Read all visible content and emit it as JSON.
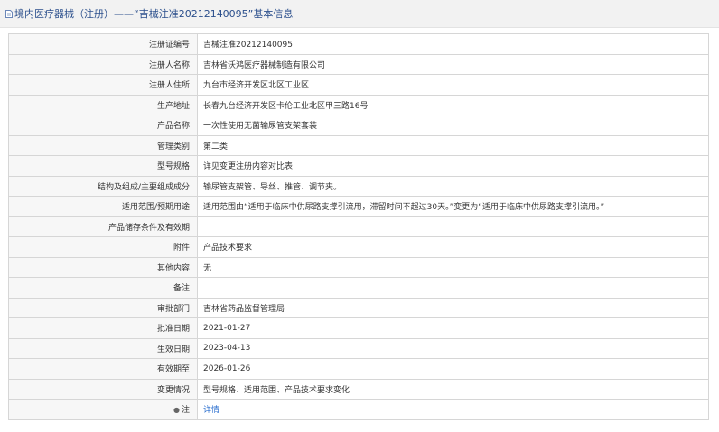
{
  "header": {
    "title": "境内医疗器械（注册）——“吉械注准20212140095”基本信息"
  },
  "rows": [
    {
      "label": "注册证编号",
      "value": "吉械注准20212140095"
    },
    {
      "label": "注册人名称",
      "value": "吉林省沃鸿医疗器械制造有限公司"
    },
    {
      "label": "注册人住所",
      "value": "九台市经济开发区北区工业区"
    },
    {
      "label": "生产地址",
      "value": "长春九台经济开发区卡伦工业北区甲三路16号"
    },
    {
      "label": "产品名称",
      "value": "一次性使用无菌输尿管支架套装"
    },
    {
      "label": "管理类别",
      "value": "第二类"
    },
    {
      "label": "型号规格",
      "value": "详见变更注册内容对比表"
    },
    {
      "label": "结构及组成/主要组成成分",
      "value": "输尿管支架管、导丝、推管、调节夹。"
    },
    {
      "label": "适用范围/预期用途",
      "value": "适用范围由“适用于临床中供尿路支撑引流用，滞留时间不超过30天。”变更为“适用于临床中供尿路支撑引流用。”"
    },
    {
      "label": "产品储存条件及有效期",
      "value": ""
    },
    {
      "label": "附件",
      "value": "产品技术要求"
    },
    {
      "label": "其他内容",
      "value": "无"
    },
    {
      "label": "备注",
      "value": ""
    },
    {
      "label": "审批部门",
      "value": "吉林省药品监督管理局"
    },
    {
      "label": "批准日期",
      "value": "2021-01-27"
    },
    {
      "label": "生效日期",
      "value": "2023-04-13"
    },
    {
      "label": "有效期至",
      "value": "2026-01-26"
    },
    {
      "label": "变更情况",
      "value": "型号规格、适用范围、产品技术要求变化"
    }
  ],
  "note_row": {
    "label": "注",
    "link": "详情"
  }
}
